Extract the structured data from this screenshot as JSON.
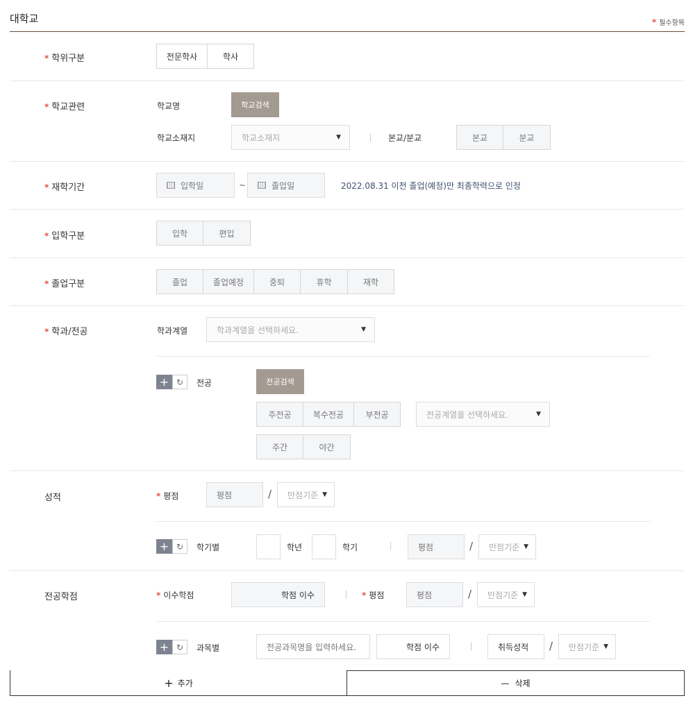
{
  "header": {
    "title": "대학교",
    "required_note": "필수항목",
    "star": "*"
  },
  "degree": {
    "label": "학위구분",
    "options": [
      "전문학사",
      "학사"
    ]
  },
  "school": {
    "label": "학교관련",
    "name_label": "학교명",
    "search_button": "학교검색",
    "location_label": "학교소재지",
    "location_placeholder": "학교소재지",
    "campus_label": "본교/분교",
    "campus_options": [
      "본교",
      "분교"
    ]
  },
  "period": {
    "label": "재학기간",
    "start_placeholder": "입학일",
    "tilde": "~",
    "end_placeholder": "졸업일",
    "note": "2022.08.31 이전 졸업(예정)만 최종학력으로 인정"
  },
  "admission": {
    "label": "입학구분",
    "options": [
      "입학",
      "편입"
    ]
  },
  "graduation": {
    "label": "졸업구분",
    "options": [
      "졸업",
      "졸업예정",
      "중퇴",
      "휴학",
      "재학"
    ]
  },
  "major": {
    "label": "학과/전공",
    "dept_label": "학과계열",
    "dept_placeholder": "학과계열을 선택하세요.",
    "major_label": "전공",
    "search_button": "전공검색",
    "type_options": [
      "주전공",
      "복수전공",
      "부전공"
    ],
    "category_placeholder": "전공계열을 선택하세요.",
    "time_options": [
      "주간",
      "야간"
    ]
  },
  "grades": {
    "label": "성적",
    "gpa_label": "평점",
    "gpa_placeholder": "평점",
    "scale_placeholder": "만점기준",
    "by_semester_label": "학기별",
    "year_unit": "학년",
    "semester_unit": "학기"
  },
  "major_credits": {
    "label": "전공학점",
    "credits_label": "이수학점",
    "credits_placeholder": "학점 이수",
    "gpa_label": "평점",
    "gpa_placeholder": "평점",
    "scale_placeholder": "만점기준",
    "by_subject_label": "과목별",
    "subject_placeholder": "전공과목명을 입력하세요.",
    "subject_credits_placeholder": "학점 이수",
    "acquired_grade_placeholder": "취득성적"
  },
  "icons": {
    "plus": "+",
    "refresh": "↻",
    "caret": "▼",
    "minus": "—"
  },
  "footer": {
    "add_label": "추가",
    "delete_label": "삭제"
  },
  "colors": {
    "accent_star": "#e0554a",
    "divider": "#6b4a33",
    "dark_button": "#a39a92",
    "plus_button": "#7d8391"
  }
}
